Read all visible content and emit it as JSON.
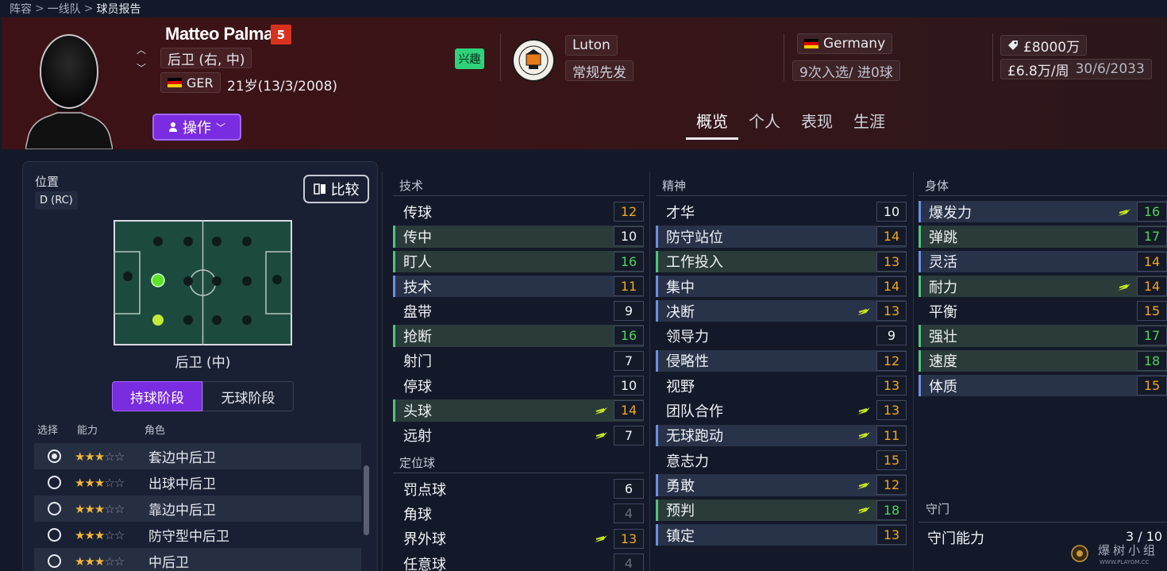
{
  "breadcrumb": {
    "items": [
      "阵容",
      "一线队",
      "球员报告"
    ]
  },
  "player": {
    "name": "Matteo Palma",
    "number": "5",
    "position": "后卫 (右, 中)",
    "nation_code": "GER",
    "age_dob": "21岁(13/3/2008)",
    "interest_badge": "兴趣",
    "action_label": "操作"
  },
  "club": {
    "name": "Luton",
    "role": "常规先发"
  },
  "international": {
    "nation": "Germany",
    "caps": "9次入选/ 进0球"
  },
  "contract": {
    "value": "£8000万",
    "wage": "£6.8万/周",
    "expiry": "30/6/2033"
  },
  "tabs": [
    "概览",
    "个人",
    "表现",
    "生涯"
  ],
  "position_panel": {
    "title": "位置",
    "code": "D (RC)",
    "compare_label": "比较",
    "role_name": "后卫 (中)",
    "phase_in": "持球阶段",
    "phase_out": "无球阶段",
    "headers": {
      "select": "选择",
      "ability": "能力",
      "role": "角色"
    },
    "roles": [
      {
        "label": "套边中后卫",
        "stars": 3,
        "selected": true
      },
      {
        "label": "出球中后卫",
        "stars": 3,
        "selected": false
      },
      {
        "label": "靠边中后卫",
        "stars": 3,
        "selected": false
      },
      {
        "label": "防守型中后卫",
        "stars": 3,
        "selected": false
      },
      {
        "label": "中后卫",
        "stars": 3,
        "selected": false
      }
    ]
  },
  "colors": {
    "accent": "#7a2ce0",
    "green": "#4ed35c",
    "orange": "#f2a51f",
    "interest": "#2fd27a"
  },
  "technical": {
    "title": "技术",
    "attrs": [
      {
        "name": "传球",
        "value": "12",
        "hl": "plain",
        "tone": "orange",
        "up": false
      },
      {
        "name": "传中",
        "value": "10",
        "hl": "green",
        "tone": "white",
        "up": false
      },
      {
        "name": "盯人",
        "value": "16",
        "hl": "green",
        "tone": "green",
        "up": false
      },
      {
        "name": "技术",
        "value": "11",
        "hl": "blue",
        "tone": "orange",
        "up": false
      },
      {
        "name": "盘带",
        "value": "9",
        "hl": "plain",
        "tone": "white",
        "up": false
      },
      {
        "name": "抢断",
        "value": "16",
        "hl": "green",
        "tone": "green",
        "up": false
      },
      {
        "name": "射门",
        "value": "7",
        "hl": "plain",
        "tone": "white",
        "up": false
      },
      {
        "name": "停球",
        "value": "10",
        "hl": "plain",
        "tone": "white",
        "up": false
      },
      {
        "name": "头球",
        "value": "14",
        "hl": "green",
        "tone": "orange",
        "up": true
      },
      {
        "name": "远射",
        "value": "7",
        "hl": "plain",
        "tone": "white",
        "up": true
      }
    ]
  },
  "set_pieces": {
    "title": "定位球",
    "attrs": [
      {
        "name": "罚点球",
        "value": "6",
        "hl": "plain",
        "tone": "white",
        "up": false
      },
      {
        "name": "角球",
        "value": "4",
        "hl": "plain",
        "tone": "gray",
        "up": false
      },
      {
        "name": "界外球",
        "value": "13",
        "hl": "plain",
        "tone": "orange",
        "up": true
      },
      {
        "name": "任意球",
        "value": "4",
        "hl": "plain",
        "tone": "gray",
        "up": false
      }
    ]
  },
  "mental": {
    "title": "精神",
    "attrs": [
      {
        "name": "才华",
        "value": "10",
        "hl": "plain",
        "tone": "white",
        "up": false
      },
      {
        "name": "防守站位",
        "value": "14",
        "hl": "blue",
        "tone": "orange",
        "up": false
      },
      {
        "name": "工作投入",
        "value": "13",
        "hl": "green",
        "tone": "orange",
        "up": false
      },
      {
        "name": "集中",
        "value": "14",
        "hl": "blue",
        "tone": "orange",
        "up": false
      },
      {
        "name": "决断",
        "value": "13",
        "hl": "blue",
        "tone": "orange",
        "up": true
      },
      {
        "name": "领导力",
        "value": "9",
        "hl": "plain",
        "tone": "white",
        "up": false
      },
      {
        "name": "侵略性",
        "value": "12",
        "hl": "blue",
        "tone": "orange",
        "up": false
      },
      {
        "name": "视野",
        "value": "13",
        "hl": "plain",
        "tone": "orange",
        "up": false
      },
      {
        "name": "团队合作",
        "value": "13",
        "hl": "plain",
        "tone": "orange",
        "up": true
      },
      {
        "name": "无球跑动",
        "value": "11",
        "hl": "blue",
        "tone": "orange",
        "up": true
      },
      {
        "name": "意志力",
        "value": "15",
        "hl": "plain",
        "tone": "orange",
        "up": false
      },
      {
        "name": "勇敢",
        "value": "12",
        "hl": "blue",
        "tone": "orange",
        "up": true
      },
      {
        "name": "预判",
        "value": "18",
        "hl": "green",
        "tone": "green",
        "up": true
      },
      {
        "name": "镇定",
        "value": "13",
        "hl": "blue",
        "tone": "orange",
        "up": false
      }
    ]
  },
  "physical": {
    "title": "身体",
    "attrs": [
      {
        "name": "爆发力",
        "value": "16",
        "hl": "blue",
        "tone": "green",
        "up": true
      },
      {
        "name": "弹跳",
        "value": "17",
        "hl": "green",
        "tone": "green",
        "up": false
      },
      {
        "name": "灵活",
        "value": "14",
        "hl": "blue",
        "tone": "orange",
        "up": false
      },
      {
        "name": "耐力",
        "value": "14",
        "hl": "green",
        "tone": "orange",
        "up": true
      },
      {
        "name": "平衡",
        "value": "15",
        "hl": "plain",
        "tone": "orange",
        "up": false
      },
      {
        "name": "强壮",
        "value": "17",
        "hl": "green",
        "tone": "green",
        "up": false
      },
      {
        "name": "速度",
        "value": "18",
        "hl": "green",
        "tone": "green",
        "up": false
      },
      {
        "name": "体质",
        "value": "15",
        "hl": "blue",
        "tone": "orange",
        "up": false
      }
    ]
  },
  "goalkeeping": {
    "title": "守门",
    "label": "守门能力",
    "value": "3 / 10"
  },
  "watermark": {
    "text": "爆树小组",
    "site": "WWW.PLAYGM.CC"
  }
}
